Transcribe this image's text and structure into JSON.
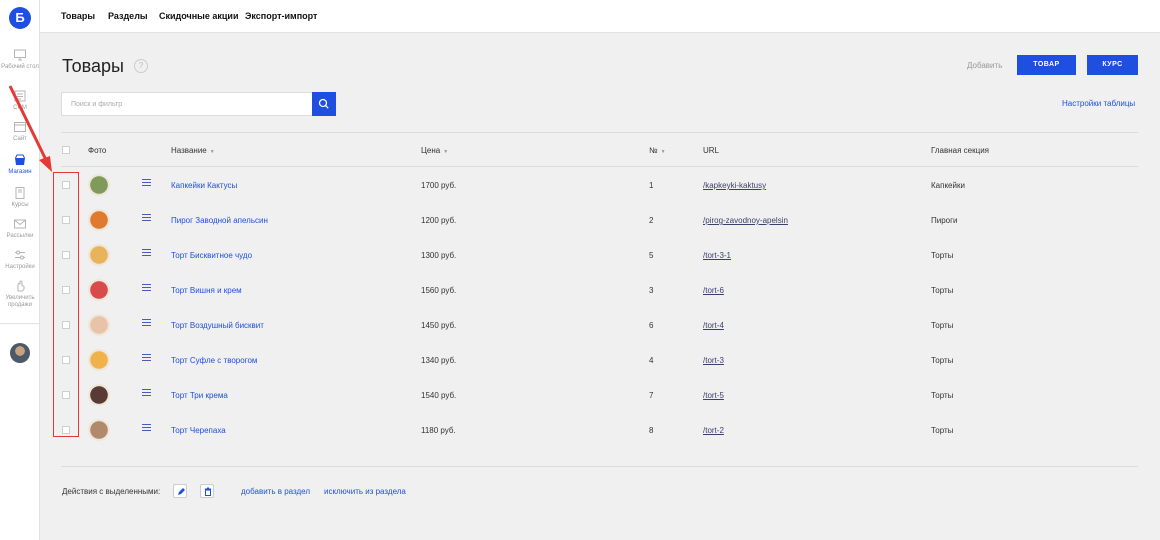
{
  "logo": "Б",
  "rail": [
    {
      "label": "Рабочий стол",
      "icon": "monitor-icon"
    },
    {
      "label": "CRM",
      "icon": "crm-icon"
    },
    {
      "label": "Сайт",
      "icon": "site-icon"
    },
    {
      "label": "Магазин",
      "icon": "shop-icon",
      "active": true
    },
    {
      "label": "Курсы",
      "icon": "courses-icon"
    },
    {
      "label": "Рассылки",
      "icon": "mail-icon"
    },
    {
      "label": "Настройки",
      "icon": "settings-icon"
    },
    {
      "label": "Увеличить продажи",
      "icon": "hand-icon"
    }
  ],
  "topnav": [
    "Товары",
    "Разделы",
    "Скидочные акции",
    "Экспорт-импорт"
  ],
  "page": {
    "title": "Товары",
    "help": "?",
    "add_label": "Добавить",
    "btn_product": "ТОВАР",
    "btn_course": "КУРС",
    "search_placeholder": "Поиск и фильтр",
    "settings_link": "Настройки таблицы"
  },
  "table": {
    "headers": {
      "photo": "Фото",
      "name": "Название",
      "price": "Цена",
      "num": "№",
      "url": "URL",
      "section": "Главная секция"
    },
    "rows": [
      {
        "name": "Капкейки Кактусы",
        "price": "1700 руб.",
        "num": "1",
        "url": "/kapkeyki-kaktusy",
        "section": "Капкейки",
        "photo_color": "#7f9a5a"
      },
      {
        "name": "Пирог Заводной апельсин",
        "price": "1200 руб.",
        "num": "2",
        "url": "/pirog-zavodnoy-apelsin",
        "section": "Пироги",
        "photo_color": "#e07a2e"
      },
      {
        "name": "Торт Бисквитное чудо",
        "price": "1300 руб.",
        "num": "5",
        "url": "/tort-3-1",
        "section": "Торты",
        "photo_color": "#e9b35a"
      },
      {
        "name": "Торт Вишня и крем",
        "price": "1560 руб.",
        "num": "3",
        "url": "/tort-6",
        "section": "Торты",
        "photo_color": "#d94a4a"
      },
      {
        "name": "Торт Воздушный бисквит",
        "price": "1450 руб.",
        "num": "6",
        "url": "/tort-4",
        "section": "Торты",
        "photo_color": "#e9c3a8"
      },
      {
        "name": "Торт Суфле с творогом",
        "price": "1340 руб.",
        "num": "4",
        "url": "/tort-3",
        "section": "Торты",
        "photo_color": "#f0b24a"
      },
      {
        "name": "Торт Три крема",
        "price": "1540 руб.",
        "num": "7",
        "url": "/tort-5",
        "section": "Торты",
        "photo_color": "#5a3a35"
      },
      {
        "name": "Торт Черепаха",
        "price": "1180 руб.",
        "num": "8",
        "url": "/tort-2",
        "section": "Торты",
        "photo_color": "#b08a6a"
      }
    ]
  },
  "footer": {
    "label": "Действия с выделенными:",
    "add_to_section": "добавить в раздел",
    "remove_from_section": "исключить из раздела"
  },
  "colors": {
    "accent": "#1f4fe0",
    "annotation": "#e53935"
  }
}
